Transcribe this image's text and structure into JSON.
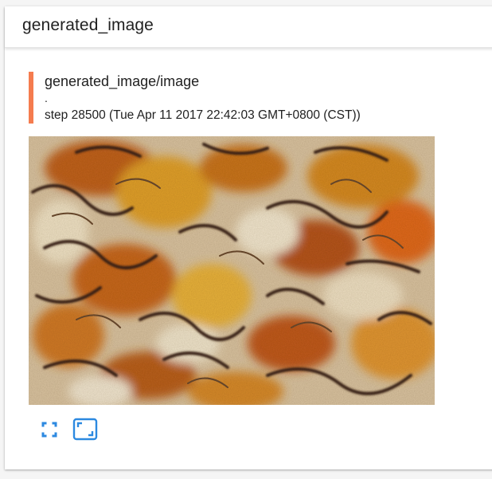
{
  "card": {
    "title": "generated_image"
  },
  "image_panel": {
    "tag": "generated_image/image",
    "run": ".",
    "step_label": "step 28500 (Tue Apr 11 2017 22:42:03 GMT+0800 (CST))"
  },
  "toolbar": {
    "buttons": [
      {
        "icon": "fullscreen-icon"
      },
      {
        "icon": "fit-to-frame-icon"
      }
    ]
  },
  "colors": {
    "accent_bar": "#f57c4f",
    "icon": "#2c89e0"
  }
}
